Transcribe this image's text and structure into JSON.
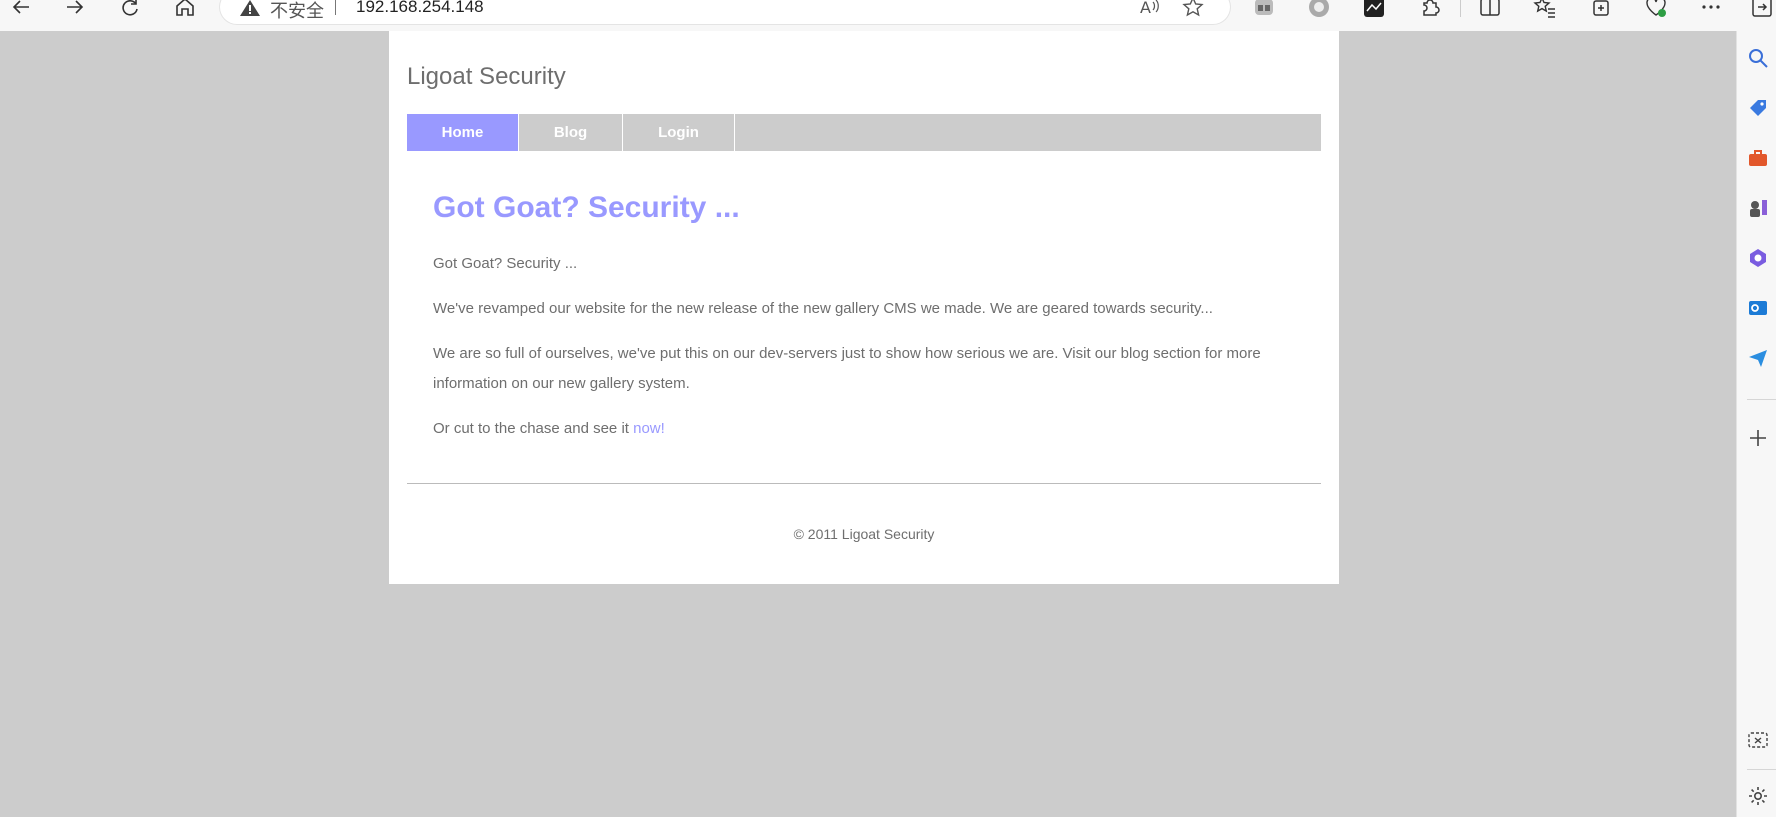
{
  "browser": {
    "security_label": "不安全",
    "url": "192.168.254.148",
    "icons": [
      "back-icon",
      "forward-icon",
      "refresh-icon",
      "home-icon",
      "warning-icon",
      "read-aloud-icon",
      "favorite-star-icon",
      "extension-icon",
      "collections-icon",
      "split-screen-icon",
      "favorites-icon",
      "more-icon"
    ]
  },
  "site": {
    "title": "Ligoat Security",
    "nav": [
      {
        "label": "Home",
        "active": true
      },
      {
        "label": "Blog",
        "active": false
      },
      {
        "label": "Login",
        "active": false
      }
    ],
    "heading": "Got Goat? Security ...",
    "p1": "Got Goat? Security ...",
    "p2": "We've revamped our website for the new release of the new gallery CMS we made. We are geared towards security...",
    "p3": "We are so full of ourselves, we've put this on our dev-servers just to show how serious we are. Visit our blog section for more information on our new gallery system.",
    "p4_prefix": "Or cut to the chase and see it ",
    "p4_link": "now!",
    "footer": "© 2011 Ligoat Security"
  },
  "colors": {
    "accent": "#9999ff",
    "nav_bg": "#cccccc",
    "text": "#6e6e6e",
    "page_bg": "#cccccc"
  }
}
